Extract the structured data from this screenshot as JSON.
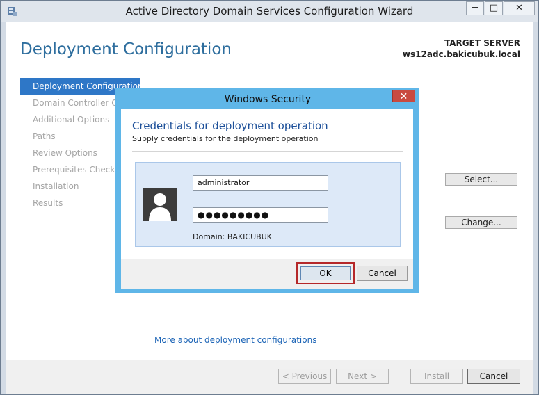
{
  "window": {
    "title": "Active Directory Domain Services Configuration Wizard",
    "minimize_glyph": "−",
    "maximize_glyph": "□",
    "close_glyph": "✕"
  },
  "page": {
    "title": "Deployment Configuration",
    "target_label": "TARGET SERVER",
    "target_value": "ws12adc.bakicubuk.local"
  },
  "nav": {
    "items": [
      "Deployment Configuration",
      "Domain Controller Options",
      "Additional Options",
      "Paths",
      "Review Options",
      "Prerequisites Check",
      "Installation",
      "Results"
    ]
  },
  "main": {
    "select_label": "Select...",
    "change_label": "Change...",
    "more_link": "More about deployment configurations"
  },
  "footer": {
    "previous": "< Previous",
    "next": "Next >",
    "install": "Install",
    "cancel": "Cancel"
  },
  "dialog": {
    "title": "Windows Security",
    "close_glyph": "✕",
    "heading": "Credentials for deployment operation",
    "subheading": "Supply credentials for the deployment operation",
    "username": "administrator",
    "password": "●●●●●●●●●",
    "domain": "Domain: BAKICUBUK",
    "ok": "OK",
    "cancel": "Cancel"
  },
  "colors": {
    "accent": "#2e77c7",
    "dialog_frame": "#5fb6e8",
    "close_red": "#c94a40",
    "highlight_red": "#b5282a"
  }
}
